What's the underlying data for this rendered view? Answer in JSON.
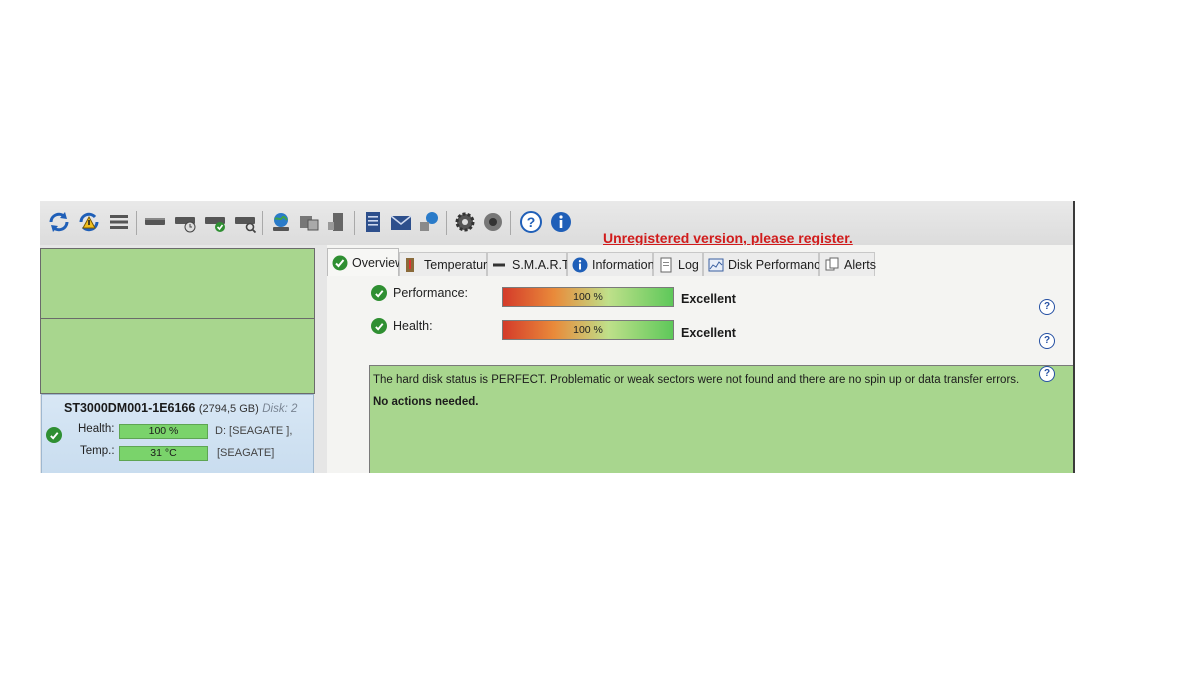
{
  "toolbar": {
    "register_link": "Unregistered version, please register.",
    "icons": [
      "refresh-icon",
      "refresh-warning-icon",
      "list-icon",
      "drive-icon",
      "drive-timer-icon",
      "drive-check-icon",
      "drive-search-icon",
      "globe-icon",
      "drive-network-icon",
      "drive-usb-icon",
      "notes-icon",
      "mail-icon",
      "network-icon",
      "gear-icon",
      "speaker-icon",
      "help-icon",
      "info-icon"
    ]
  },
  "left_panel": {
    "disk": {
      "model": "ST3000DM001-1E6166",
      "size": "(2794,5 GB)",
      "disk_label": "Disk: 2",
      "health_label": "Health:",
      "health_value": "100 %",
      "temp_label": "Temp.:",
      "temp_value": "31 °C",
      "drive_line1": "D: [SEAGATE ],",
      "drive_line2": "[SEAGATE]"
    }
  },
  "tabs": [
    {
      "label": "Overview",
      "icon": "check-icon"
    },
    {
      "label": "Temperature",
      "icon": "thermometer-icon"
    },
    {
      "label": "S.M.A.R.T.",
      "icon": "dash-icon"
    },
    {
      "label": "Information",
      "icon": "info-icon"
    },
    {
      "label": "Log",
      "icon": "document-icon"
    },
    {
      "label": "Disk Performance",
      "icon": "chart-icon"
    },
    {
      "label": "Alerts",
      "icon": "alerts-icon"
    }
  ],
  "overview": {
    "performance": {
      "label": "Performance:",
      "value": "100 %",
      "rating": "Excellent"
    },
    "health": {
      "label": "Health:",
      "value": "100 %",
      "rating": "Excellent"
    },
    "status_text": "The hard disk status is PERFECT. Problematic or weak sectors were not found and there are no spin up or data transfer errors.",
    "action_text": "No actions needed.",
    "help_glyph": "?"
  },
  "colors": {
    "status_green": "#a8d68e",
    "register_red": "#d11b1b",
    "check_green": "#2f8f32"
  }
}
